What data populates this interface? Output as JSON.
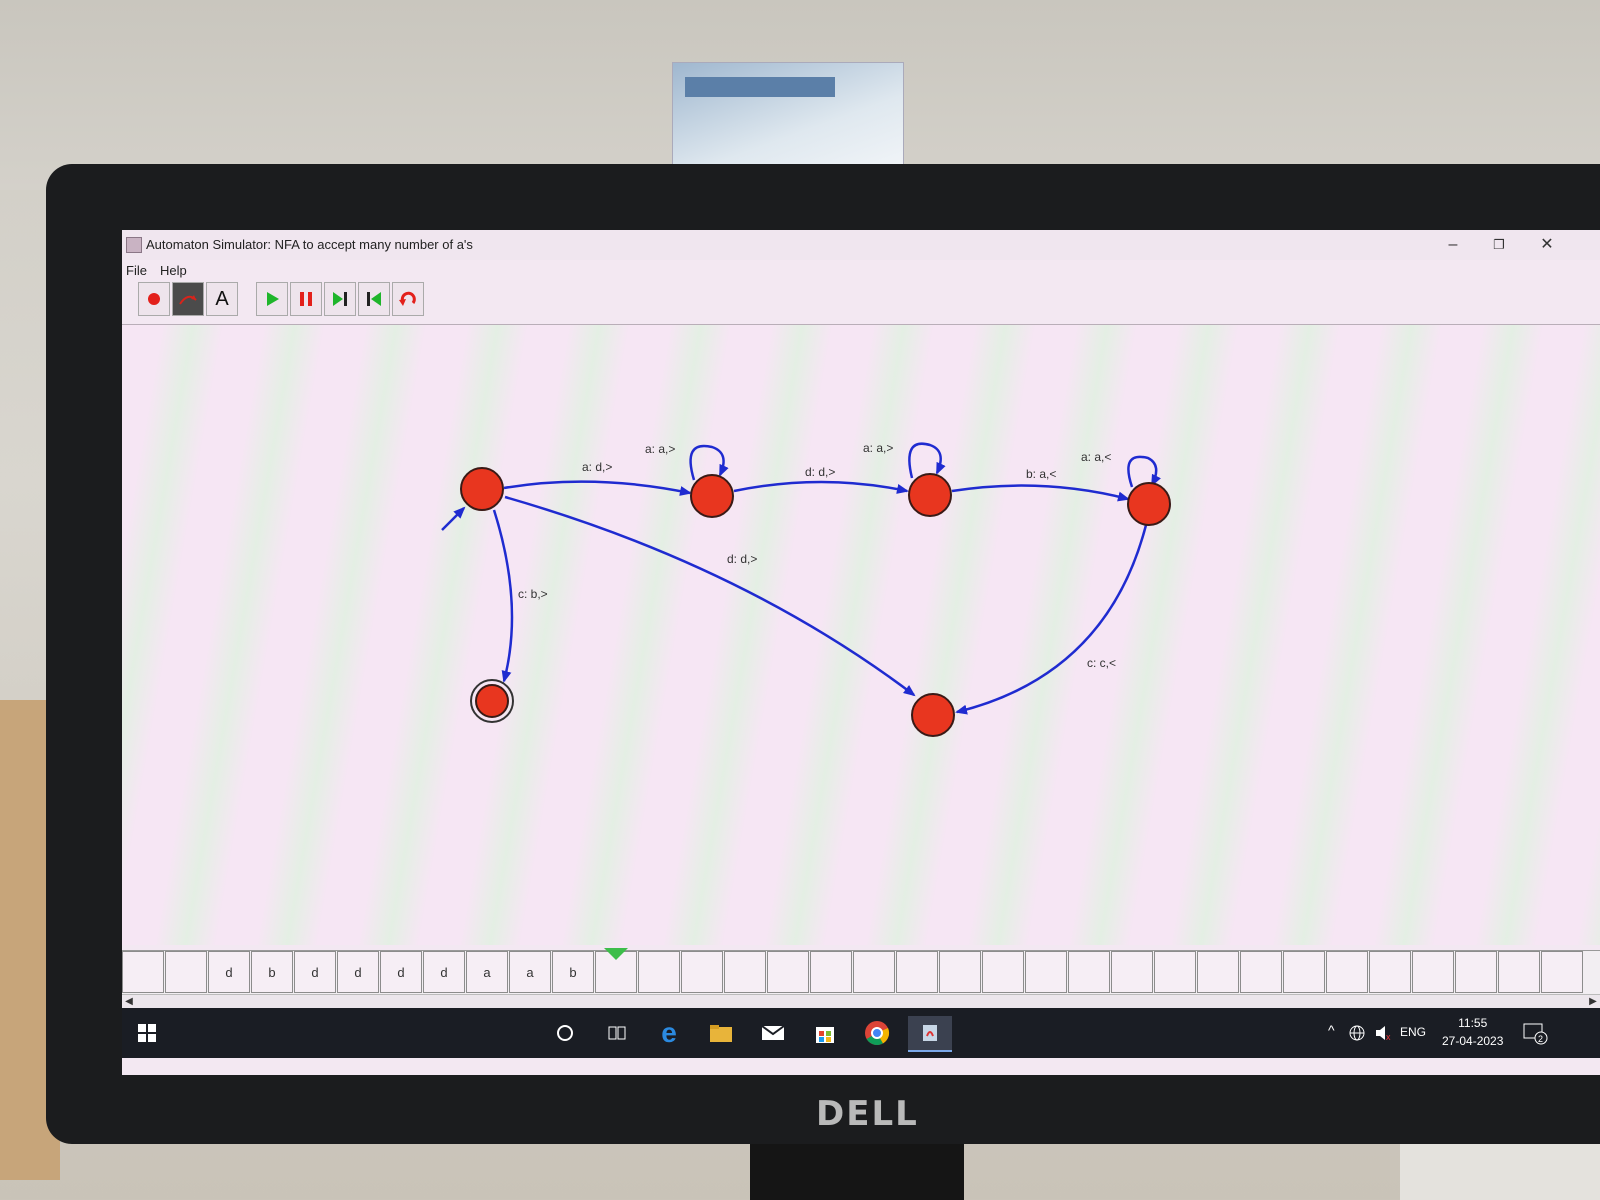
{
  "window": {
    "title": "Automaton Simulator: NFA to accept many number of a's",
    "minimize": "–",
    "restore": "❐",
    "close": "✕"
  },
  "menu": [
    "File",
    "Help"
  ],
  "toolbar": {
    "text_tool_label": "A"
  },
  "automaton": {
    "states": [
      "q0",
      "q1",
      "q2",
      "q3",
      "q4",
      "q5"
    ],
    "initial_state": "q0",
    "final_states": [
      "q5"
    ],
    "transitions": [
      {
        "from": "q0",
        "to": "q1",
        "label": "a: d,>"
      },
      {
        "from": "q1",
        "to": "q1",
        "label": "a: a,>"
      },
      {
        "from": "q1",
        "to": "q2",
        "label": "d: d,>"
      },
      {
        "from": "q2",
        "to": "q2",
        "label": "a: a,>"
      },
      {
        "from": "q2",
        "to": "q3",
        "label": "b: a,<"
      },
      {
        "from": "q3",
        "to": "q3",
        "label": "a: a,<"
      },
      {
        "from": "q3",
        "to": "q4",
        "label": "c: c,<"
      },
      {
        "from": "q0",
        "to": "q4",
        "label": "d: d,>"
      },
      {
        "from": "q0",
        "to": "q5",
        "label": "c: b,>"
      }
    ],
    "colors": {
      "state_fill": "#e8361f",
      "edge": "#1f2bd0"
    }
  },
  "tape": {
    "cells": [
      "",
      "",
      "d",
      "b",
      "d",
      "d",
      "d",
      "d",
      "a",
      "a",
      "b",
      "",
      "",
      "",
      "",
      "",
      "",
      "",
      "",
      "",
      "",
      "",
      "",
      "",
      "",
      "",
      "",
      "",
      "",
      "",
      "",
      "",
      "",
      ""
    ],
    "head_index": 11
  },
  "taskbar": {
    "language": "ENG",
    "time": "11:55",
    "date": "27-04-2023",
    "notification_count": "2"
  },
  "brand": "DELL"
}
